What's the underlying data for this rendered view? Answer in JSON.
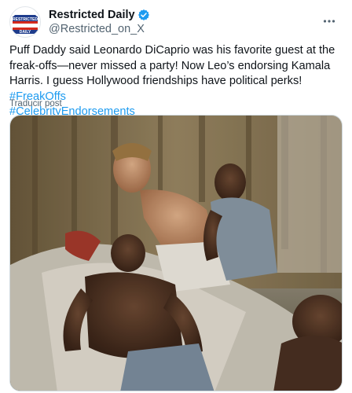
{
  "author": {
    "display_name": "Restricted Daily",
    "handle": "@Restricted_on_X",
    "avatar_text_top": "RESTRICTED",
    "avatar_text_bottom": "DAILY",
    "verified_color": "#1d9bf0"
  },
  "tweet": {
    "text": "Puff Daddy said Leonardo DiCaprio was his favorite guest at the freak-offs—never missed a party! Now Leo’s endorsing Kamala Harris. I guess Hollywood friendships have political perks!",
    "hashtags": [
      "#FreakOffs",
      "#CelebrityEndorsements"
    ],
    "translate_label": "Traducir post"
  },
  "icons": {
    "more": "more-dots-icon",
    "verified": "verified-badge-icon"
  },
  "colors": {
    "text": "#0f1419",
    "secondary": "#536471",
    "link": "#1d9bf0"
  }
}
